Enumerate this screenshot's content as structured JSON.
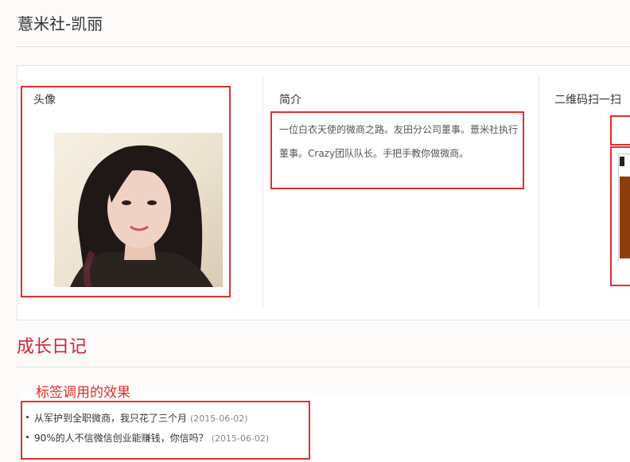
{
  "page": {
    "title": "薏米社-凯丽"
  },
  "profile": {
    "avatar_label": "头像",
    "intro_label": "简介",
    "intro_text": "一位白衣天使的微商之路。友田分公司董事。薏米社执行董事。Crazy团队队长。手把手教你做微商。",
    "qr_label": "二维码扫一扫"
  },
  "diary": {
    "title": "成长日记",
    "annotation": "标签调用的效果",
    "items": [
      {
        "text": "从军护到全职微商，我只花了三个月",
        "date": "(2015-06-02)"
      },
      {
        "text": "90%的人不信微信创业能赚钱，你信吗？",
        "date": "(2015-06-02)"
      }
    ]
  },
  "colors": {
    "accent": "#d0243a",
    "highlight_box": "#e0302c",
    "qr_image": "#8e3d0f"
  }
}
